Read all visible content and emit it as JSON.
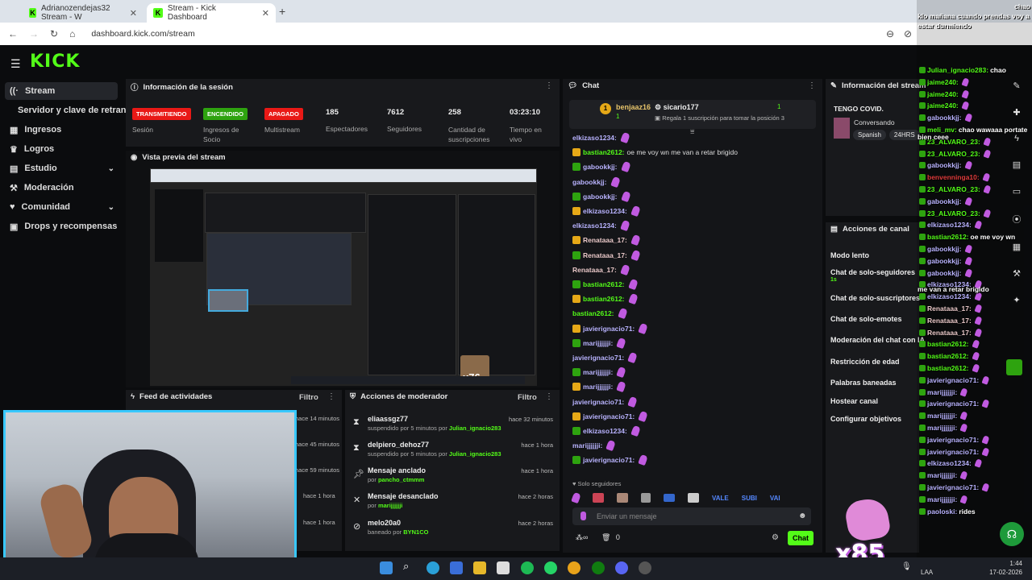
{
  "browser": {
    "tabs": [
      {
        "label": "Adrianozendejas32 Stream - W"
      },
      {
        "label": "Stream - Kick Dashboard"
      }
    ],
    "url": "dashboard.kick.com/stream"
  },
  "header": {
    "logo": "KICK"
  },
  "sidebar": {
    "items": [
      {
        "label": "Stream",
        "icon": "signal-icon"
      },
      {
        "label": "Servidor y clave de retransm"
      },
      {
        "label": "Ingresos",
        "icon": "grid-icon"
      },
      {
        "label": "Logros",
        "icon": "trophy-icon"
      },
      {
        "label": "Estudio",
        "icon": "studio-icon"
      },
      {
        "label": "Moderación",
        "icon": "wrench-icon"
      },
      {
        "label": "Comunidad",
        "icon": "community-icon"
      },
      {
        "label": "Drops y recompensas",
        "icon": "gift-icon"
      }
    ]
  },
  "session": {
    "title": "Información de la sesión",
    "stats": [
      {
        "badge": "TRANSMITIENDO",
        "badge_color": "#e91916",
        "label": "Sesión"
      },
      {
        "badge": "ENCENDIDO",
        "badge_color": "#2ea30f",
        "label": "Ingresos de Socio"
      },
      {
        "badge": "APAGADO",
        "badge_color": "#e91916",
        "label": "Multistream"
      },
      {
        "value": "185",
        "label": "Espectadores"
      },
      {
        "value": "7612",
        "label": "Seguidores"
      },
      {
        "value": "258",
        "label": "Cantidad de suscripciones"
      },
      {
        "value": "03:23:10",
        "label": "Tiempo en vivo"
      }
    ]
  },
  "preview": {
    "title": "Vista previa del stream",
    "overlay_count": "x76"
  },
  "feed": {
    "title": "Feed de actividades",
    "filter": "Filtro",
    "times": [
      "hace 14 minutos",
      "hace 45 minutos",
      "hace 59 minutos",
      "hace 1 hora",
      "hace 1 hora"
    ]
  },
  "mod_actions": {
    "title": "Acciones de moderador",
    "filter": "Filtro",
    "items": [
      {
        "icon": "hourglass-icon",
        "user": "eliaassgz77",
        "detail": "suspendido por 5 minutos por",
        "by": "Julian_ignacio283",
        "time": "hace 32 minutos"
      },
      {
        "icon": "hourglass-icon",
        "user": "delpiero_dehoz77",
        "detail": "suspendido por 5 minutos por",
        "by": "Julian_ignacio283",
        "time": "hace 1 hora"
      },
      {
        "icon": "pin-icon",
        "user": "Mensaje anclado",
        "detail": "por",
        "by": "pancho_ctmmm",
        "time": "hace 1 hora"
      },
      {
        "icon": "unpin-icon",
        "user": "Mensaje desanclado",
        "detail": "por",
        "by": "marijjjjjji",
        "time": "hace 2 horas"
      },
      {
        "icon": "ban-icon",
        "user": "melo20a0",
        "detail": "baneado por",
        "by": "BYN1CO",
        "time": "hace 2 horas"
      }
    ]
  },
  "chat": {
    "title": "Chat",
    "pinned": {
      "user1": "benjaaz16",
      "user1_sub": "1",
      "user2": "sicario177",
      "user2_count": "1",
      "promo": "Regala 1 suscripción para tomar la posición 3"
    },
    "messages": [
      {
        "user": "elkizaso1234:",
        "color": "#b9b3ff",
        "text": ""
      },
      {
        "user": "bastian2612:",
        "color": "#53fc18",
        "text": "oe me voy wn me van a retar brigido"
      },
      {
        "user": "gabookkjj:",
        "color": "#b9b3ff",
        "text": ""
      },
      {
        "user": "gabookkjj:",
        "color": "#b9b3ff",
        "text": ""
      },
      {
        "user": "gabookkjj:",
        "color": "#b9b3ff",
        "text": ""
      },
      {
        "user": "elkizaso1234:",
        "color": "#b9b3ff",
        "text": ""
      },
      {
        "user": "elkizaso1234:",
        "color": "#b9b3ff",
        "text": ""
      },
      {
        "user": "Renataaa_17:",
        "color": "#e8c7c7",
        "text": ""
      },
      {
        "user": "Renataaa_17:",
        "color": "#e8c7c7",
        "text": ""
      },
      {
        "user": "Renataaa_17:",
        "color": "#e8c7c7",
        "text": ""
      },
      {
        "user": "bastian2612:",
        "color": "#53fc18",
        "text": ""
      },
      {
        "user": "bastian2612:",
        "color": "#53fc18",
        "text": ""
      },
      {
        "user": "bastian2612:",
        "color": "#53fc18",
        "text": ""
      },
      {
        "user": "javierignacio71:",
        "color": "#b9b3ff",
        "text": ""
      },
      {
        "user": "marijjjjjji:",
        "color": "#b9b3ff",
        "text": ""
      },
      {
        "user": "javierignacio71:",
        "color": "#b9b3ff",
        "text": ""
      },
      {
        "user": "marijjjjjji:",
        "color": "#b9b3ff",
        "text": ""
      },
      {
        "user": "marijjjjjji:",
        "color": "#b9b3ff",
        "text": ""
      },
      {
        "user": "javierignacio71:",
        "color": "#b9b3ff",
        "text": ""
      },
      {
        "user": "javierignacio71:",
        "color": "#b9b3ff",
        "text": ""
      },
      {
        "user": "elkizaso1234:",
        "color": "#b9b3ff",
        "text": ""
      },
      {
        "user": "marijjjjjji:",
        "color": "#b9b3ff",
        "text": ""
      },
      {
        "user": "javierignacio71:",
        "color": "#b9b3ff",
        "text": ""
      }
    ],
    "followers_only": "Solo seguidores",
    "emotes": [
      "VALE",
      "SUBI",
      "VAI"
    ],
    "input_placeholder": "Enviar un mensaje",
    "footer_count": "0",
    "send_label": "Chat"
  },
  "stream_info": {
    "title": "Información del stream",
    "stream_title": "TENGO COVID.",
    "category": "Conversando",
    "tags": [
      "Spanish",
      "24HRS"
    ]
  },
  "channel_actions": {
    "title": "Acciones de canal",
    "items": [
      "Modo lento",
      "Chat de solo-seguidores",
      "Chat de solo-suscriptores",
      "Chat de solo-emotes",
      "Moderación del chat con IA",
      "Restricción de edad",
      "Palabras baneadas",
      "Hostear canal",
      "Configurar objetivos"
    ],
    "slow_sub": "1s"
  },
  "overlay_chat": {
    "top_lines": [
      "chao",
      "klo mañana cuando prendas voy a",
      "estar durmiendo"
    ],
    "lines": [
      {
        "user": "Julian_ignacio283:",
        "text": "chao",
        "color": "#53fc18"
      },
      {
        "user": "jaime240:",
        "text": "",
        "color": "#53fc18"
      },
      {
        "user": "jaime240:",
        "text": "",
        "color": "#53fc18"
      },
      {
        "user": "jaime240:",
        "text": "",
        "color": "#53fc18"
      },
      {
        "user": "gabookkjj:",
        "text": "",
        "color": "#b9b3ff"
      },
      {
        "user": "meli_mv:",
        "text": "chao wawaaa portate",
        "color": "#53fc18"
      },
      {
        "user": "23_ALVARO_23:",
        "text": "",
        "color": "#53fc18"
      },
      {
        "user": "23_ALVARO_23:",
        "text": "",
        "color": "#53fc18"
      },
      {
        "user": "gabookkjj:",
        "text": "",
        "color": "#b9b3ff"
      },
      {
        "user": "benvenninga10:",
        "text": "",
        "color": "#e03c3c"
      },
      {
        "user": "23_ALVARO_23:",
        "text": "",
        "color": "#53fc18"
      },
      {
        "user": "gabookkjj:",
        "text": "",
        "color": "#b9b3ff"
      },
      {
        "user": "23_ALVARO_23:",
        "text": "",
        "color": "#53fc18"
      },
      {
        "user": "elkizaso1234:",
        "text": "",
        "color": "#b9b3ff"
      },
      {
        "user": "bastian2612:",
        "text": "oe me voy wn",
        "color": "#53fc18"
      },
      {
        "user": "gabookkjj:",
        "text": "",
        "color": "#b9b3ff"
      },
      {
        "user": "gabookkjj:",
        "text": "",
        "color": "#b9b3ff"
      },
      {
        "user": "gabookkjj:",
        "text": "",
        "color": "#b9b3ff"
      },
      {
        "user": "elkizaso1234:",
        "text": "",
        "color": "#b9b3ff"
      },
      {
        "user": "elkizaso1234:",
        "text": "",
        "color": "#b9b3ff"
      },
      {
        "user": "Renataaa_17:",
        "text": "",
        "color": "#e8c7c7"
      },
      {
        "user": "Renataaa_17:",
        "text": "",
        "color": "#e8c7c7"
      },
      {
        "user": "Renataaa_17:",
        "text": "",
        "color": "#e8c7c7"
      },
      {
        "user": "bastian2612:",
        "text": "",
        "color": "#53fc18"
      },
      {
        "user": "bastian2612:",
        "text": "",
        "color": "#53fc18"
      },
      {
        "user": "bastian2612:",
        "text": "",
        "color": "#53fc18"
      },
      {
        "user": "javierignacio71:",
        "text": "",
        "color": "#b9b3ff"
      },
      {
        "user": "marijjjjjji:",
        "text": "",
        "color": "#b9b3ff"
      },
      {
        "user": "javierignacio71:",
        "text": "",
        "color": "#b9b3ff"
      },
      {
        "user": "marijjjjjji:",
        "text": "",
        "color": "#b9b3ff"
      },
      {
        "user": "marijjjjjji:",
        "text": "",
        "color": "#b9b3ff"
      },
      {
        "user": "javierignacio71:",
        "text": "",
        "color": "#b9b3ff"
      },
      {
        "user": "javierignacio71:",
        "text": "",
        "color": "#b9b3ff"
      },
      {
        "user": "elkizaso1234:",
        "text": "",
        "color": "#b9b3ff"
      },
      {
        "user": "marijjjjjji:",
        "text": "",
        "color": "#b9b3ff"
      },
      {
        "user": "javierignacio71:",
        "text": "",
        "color": "#b9b3ff"
      },
      {
        "user": "marijjjjjji:",
        "text": "",
        "color": "#b9b3ff"
      },
      {
        "user": "paoloski:",
        "text": "rides",
        "color": "#b9b3ff"
      }
    ],
    "wrap_lines": [
      "bien ceee",
      "me van a retar brigido"
    ],
    "combo": "x85"
  },
  "taskbar": {
    "lang": "LAA",
    "time": "1:44",
    "date": "17-02-2026"
  },
  "colors": {
    "accent": "#53fc18",
    "panel": "#18191c",
    "bg": "#0b0c0e",
    "live": "#e91916"
  }
}
